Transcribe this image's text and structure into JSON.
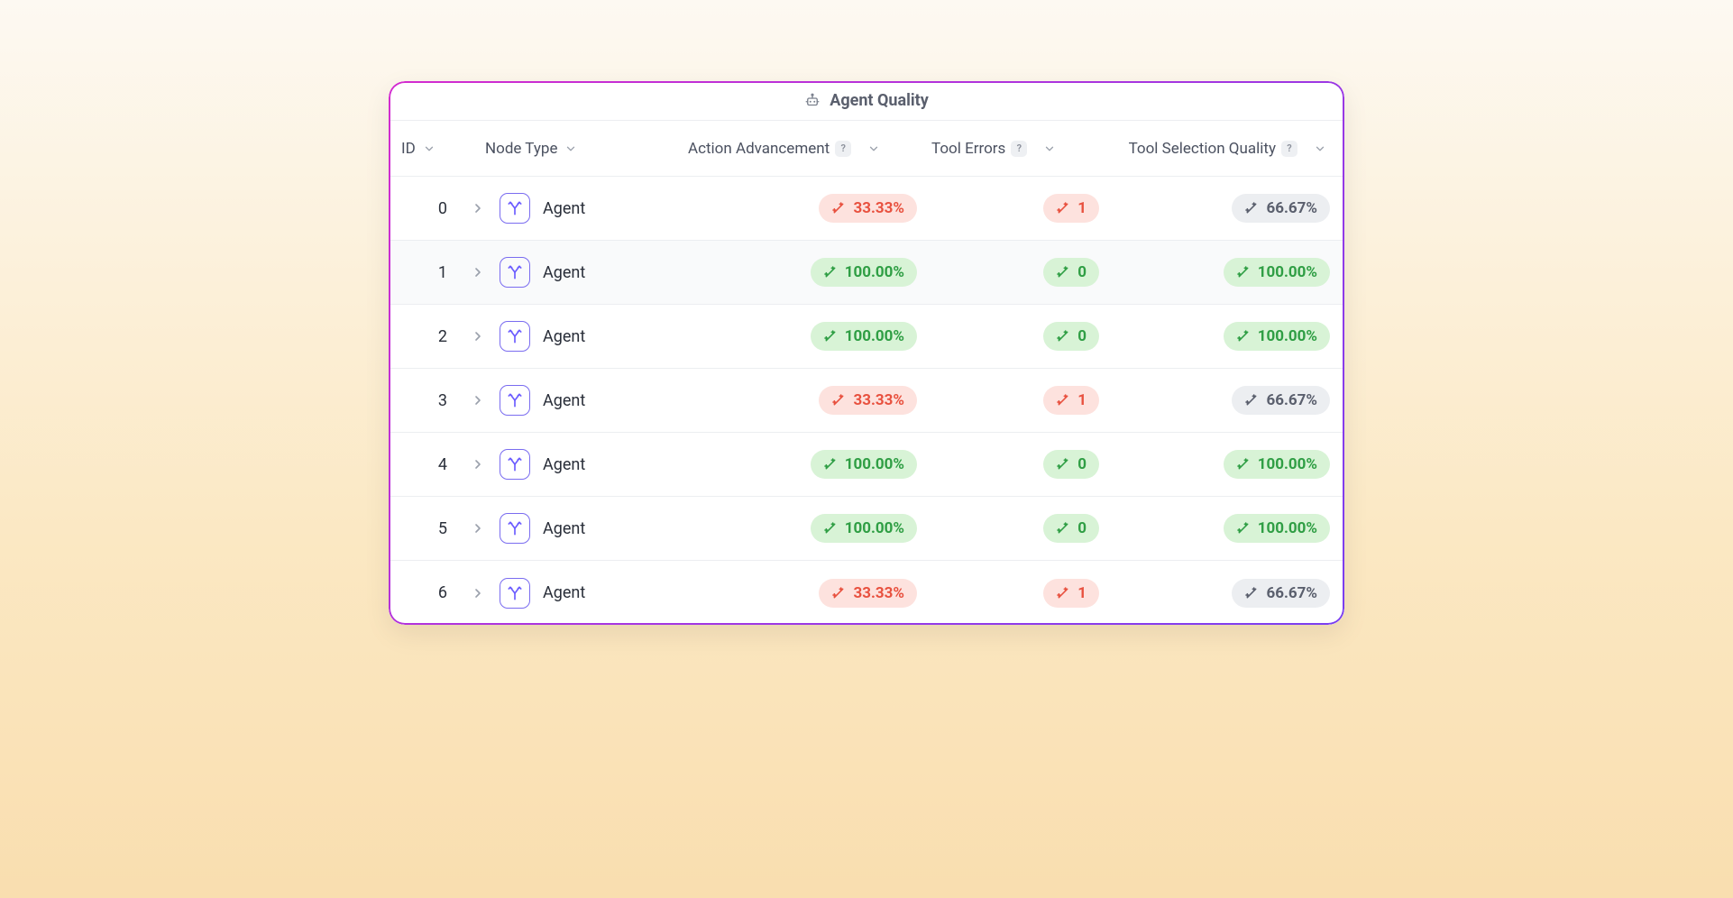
{
  "title": "Agent Quality",
  "columns": {
    "id": "ID",
    "node_type": "Node Type",
    "action_advancement": "Action Advancement",
    "tool_errors": "Tool Errors",
    "tool_selection_quality": "Tool Selection Quality"
  },
  "node_label": "Agent",
  "rows": [
    {
      "id": "0",
      "action": {
        "value": "33.33%",
        "tone": "red"
      },
      "tool": {
        "value": "1",
        "tone": "red"
      },
      "tsq": {
        "value": "66.67%",
        "tone": "gray"
      }
    },
    {
      "id": "1",
      "action": {
        "value": "100.00%",
        "tone": "green"
      },
      "tool": {
        "value": "0",
        "tone": "green"
      },
      "tsq": {
        "value": "100.00%",
        "tone": "green"
      },
      "alt": true
    },
    {
      "id": "2",
      "action": {
        "value": "100.00%",
        "tone": "green"
      },
      "tool": {
        "value": "0",
        "tone": "green"
      },
      "tsq": {
        "value": "100.00%",
        "tone": "green"
      }
    },
    {
      "id": "3",
      "action": {
        "value": "33.33%",
        "tone": "red"
      },
      "tool": {
        "value": "1",
        "tone": "red"
      },
      "tsq": {
        "value": "66.67%",
        "tone": "gray"
      }
    },
    {
      "id": "4",
      "action": {
        "value": "100.00%",
        "tone": "green"
      },
      "tool": {
        "value": "0",
        "tone": "green"
      },
      "tsq": {
        "value": "100.00%",
        "tone": "green"
      }
    },
    {
      "id": "5",
      "action": {
        "value": "100.00%",
        "tone": "green"
      },
      "tool": {
        "value": "0",
        "tone": "green"
      },
      "tsq": {
        "value": "100.00%",
        "tone": "green"
      }
    },
    {
      "id": "6",
      "action": {
        "value": "33.33%",
        "tone": "red"
      },
      "tool": {
        "value": "1",
        "tone": "red"
      },
      "tsq": {
        "value": "66.67%",
        "tone": "gray"
      }
    }
  ],
  "chart_data": {
    "type": "table",
    "columns": [
      "ID",
      "Node Type",
      "Action Advancement",
      "Tool Errors",
      "Tool Selection Quality"
    ],
    "rows": [
      [
        0,
        "Agent",
        33.33,
        1,
        66.67
      ],
      [
        1,
        "Agent",
        100.0,
        0,
        100.0
      ],
      [
        2,
        "Agent",
        100.0,
        0,
        100.0
      ],
      [
        3,
        "Agent",
        33.33,
        1,
        66.67
      ],
      [
        4,
        "Agent",
        100.0,
        0,
        100.0
      ],
      [
        5,
        "Agent",
        100.0,
        0,
        100.0
      ],
      [
        6,
        "Agent",
        33.33,
        1,
        66.67
      ]
    ]
  }
}
